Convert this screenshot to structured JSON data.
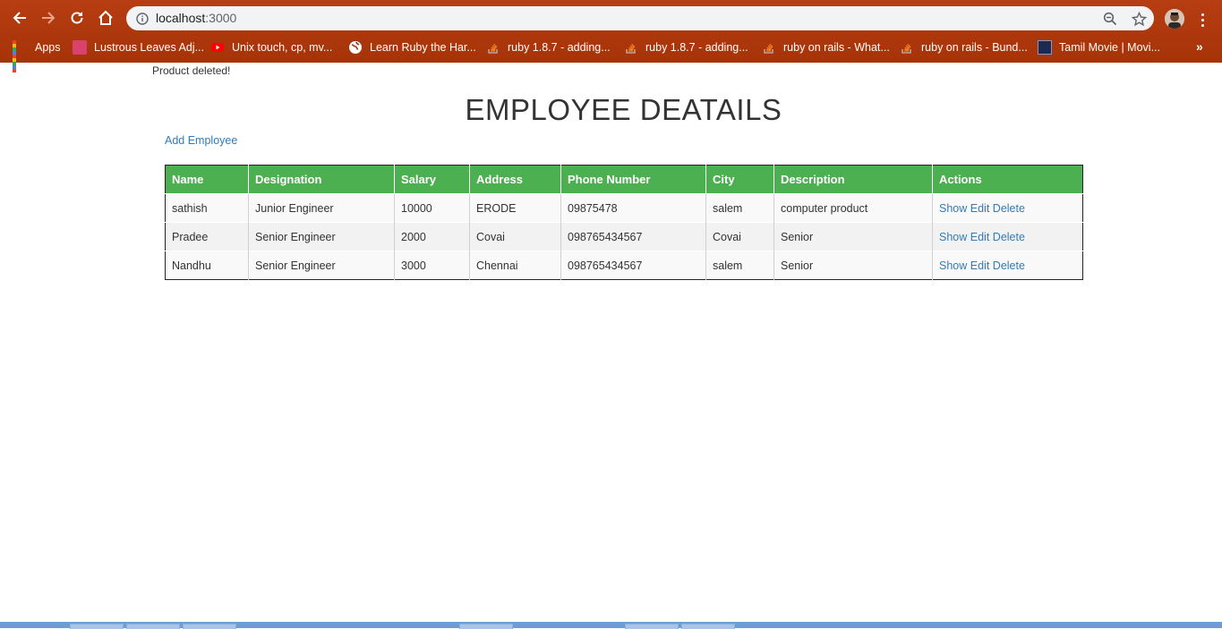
{
  "browser": {
    "url_host": "localhost",
    "url_port": ":3000",
    "bookmarks": [
      {
        "label": "Apps",
        "icon": "apps-grid-icon"
      },
      {
        "label": "Lustrous Leaves Adj...",
        "icon": "bookmark-favicon"
      },
      {
        "label": "Unix touch, cp, mv...",
        "icon": "youtube-icon"
      },
      {
        "label": "Learn Ruby the Har...",
        "icon": "globe-icon"
      },
      {
        "label": "ruby 1.8.7 - adding...",
        "icon": "stackoverflow-icon"
      },
      {
        "label": "ruby 1.8.7 - adding...",
        "icon": "stackoverflow-icon"
      },
      {
        "label": "ruby on rails - What...",
        "icon": "stackoverflow-icon"
      },
      {
        "label": "ruby on rails - Bund...",
        "icon": "stackoverflow-icon"
      },
      {
        "label": "Tamil Movie | Movi...",
        "icon": "bookmark-favicon"
      }
    ],
    "overflow": "»"
  },
  "page": {
    "flash": "Product deleted!",
    "title": "EMPLOYEE DEATAILS",
    "add_link": "Add Employee"
  },
  "table": {
    "headers": [
      "Name",
      "Designation",
      "Salary",
      "Address",
      "Phone Number",
      "City",
      "Description",
      "Actions"
    ],
    "rows": [
      {
        "name": "sathish",
        "designation": "Junior Engineer",
        "salary": "10000",
        "address": "ERODE",
        "phone": "09875478",
        "city": "salem",
        "description": "computer product"
      },
      {
        "name": "Pradee",
        "designation": "Senior Engineer",
        "salary": "2000",
        "address": "Covai",
        "phone": "098765434567",
        "city": "Covai",
        "description": "Senior"
      },
      {
        "name": "Nandhu",
        "designation": "Senior Engineer",
        "salary": "3000",
        "address": "Chennai",
        "phone": "098765434567",
        "city": "salem",
        "description": "Senior"
      }
    ],
    "actions": {
      "show": "Show",
      "edit": "Edit",
      "delete": "Delete"
    }
  },
  "colors": {
    "chrome": "#b03a0f",
    "header_green": "#4caf50",
    "link": "#337ab7"
  }
}
